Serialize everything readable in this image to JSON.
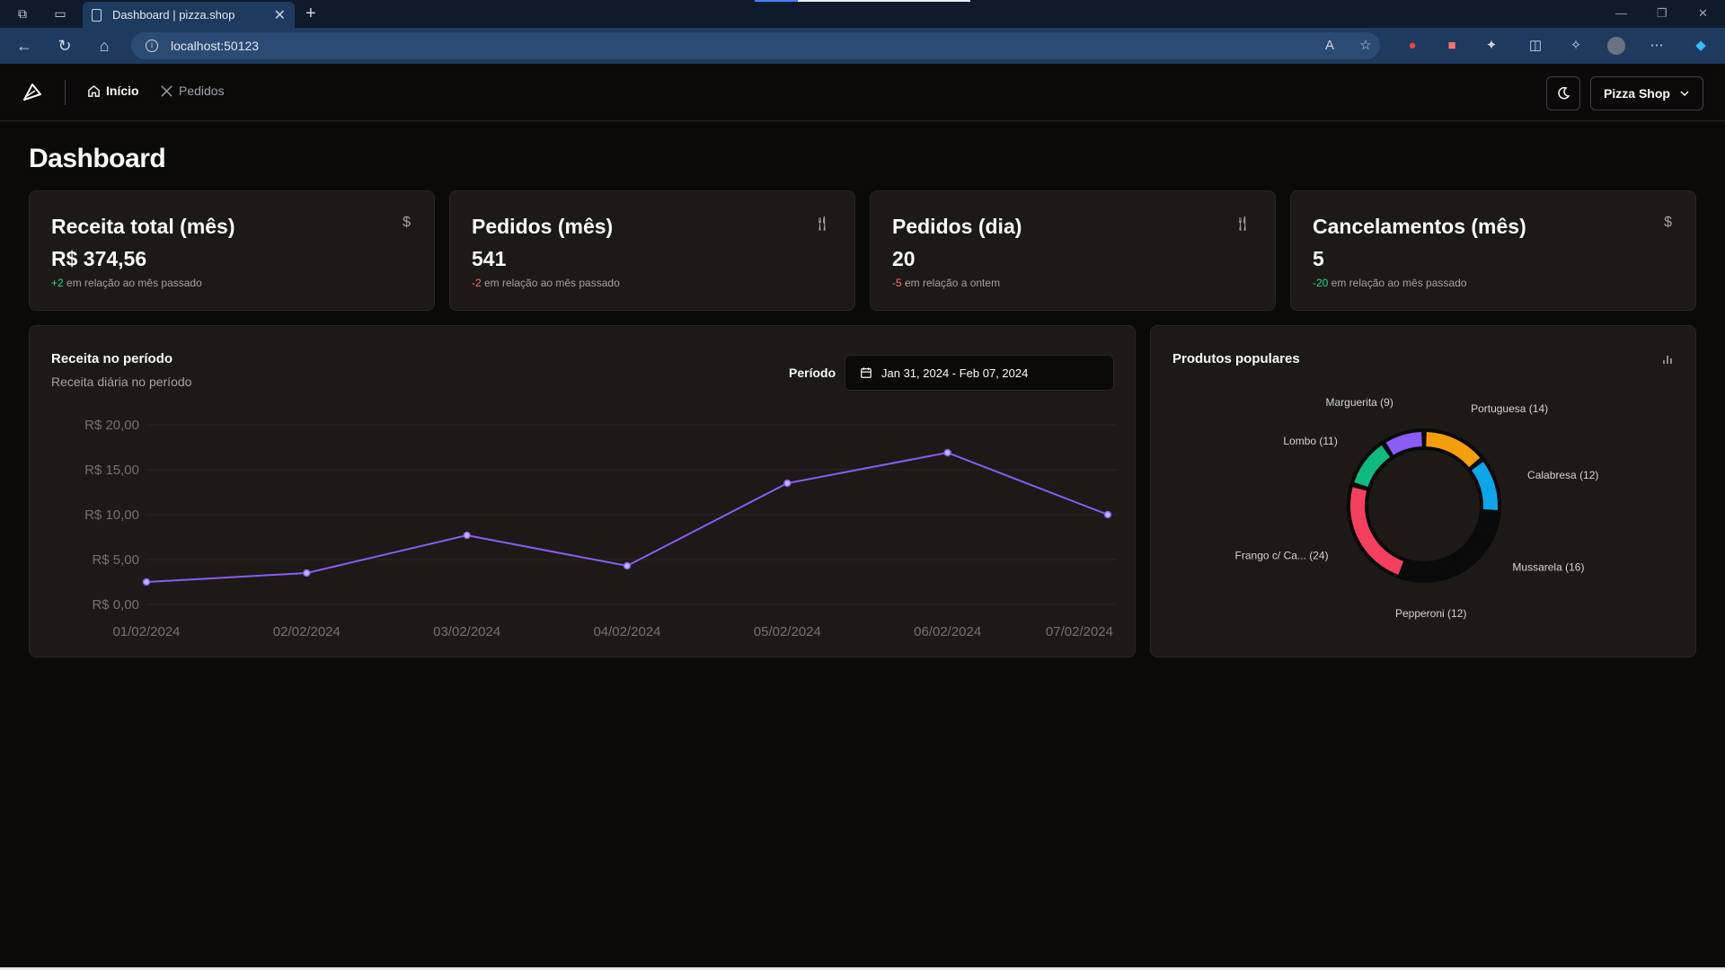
{
  "browser": {
    "tab_title": "Dashboard | pizza.shop",
    "url": "localhost:50123"
  },
  "nav": {
    "items": [
      {
        "label": "Início"
      },
      {
        "label": "Pedidos"
      }
    ],
    "shop_label": "Pizza Shop"
  },
  "page": {
    "title": "Dashboard"
  },
  "stats": [
    {
      "label": "Receita total (mês)",
      "icon": "dollar-icon",
      "value": "R$ 374,56",
      "delta": "+2",
      "delta_color": "#34d399",
      "note": " em relação ao mês passado"
    },
    {
      "label": "Pedidos (mês)",
      "icon": "utensils-icon",
      "value": "541",
      "delta": "-2",
      "delta_color": "#f87171",
      "note": " em relação ao mês passado"
    },
    {
      "label": "Pedidos (dia)",
      "icon": "utensils-icon",
      "value": "20",
      "delta": "-5",
      "delta_color": "#f87171",
      "note": " em relação a ontem"
    },
    {
      "label": "Cancelamentos (mês)",
      "icon": "dollar-icon",
      "value": "5",
      "delta": "-20",
      "delta_color": "#34d399",
      "note": " em relação ao mês passado"
    }
  ],
  "revenue": {
    "title": "Receita no período",
    "subtitle": "Receita diária no período",
    "period_label": "Período",
    "date_range": "Jan 31, 2024 - Feb 07, 2024"
  },
  "popular": {
    "title": "Produtos populares"
  },
  "chart_data": [
    {
      "type": "line",
      "title": "Receita no período",
      "x": [
        "01/02/2024",
        "02/02/2024",
        "03/02/2024",
        "04/02/2024",
        "05/02/2024",
        "06/02/2024",
        "07/02/2024"
      ],
      "series": [
        {
          "values": [
            2.5,
            3.5,
            7.7,
            4.3,
            13.5,
            16.9,
            10.0
          ]
        }
      ],
      "yticks": [
        "R$ 0,00",
        "R$ 5,00",
        "R$ 10,00",
        "R$ 15,00",
        "R$ 20,00"
      ],
      "ylim": [
        0,
        20
      ],
      "color": "#8b5cf6",
      "grid": true
    },
    {
      "type": "pie",
      "title": "Produtos populares",
      "slices": [
        {
          "label": "Portuguesa (14)",
          "value": 14,
          "color": "#f59e0b"
        },
        {
          "label": "Calabresa (12)",
          "value": 12,
          "color": "#0ea5e9"
        },
        {
          "label": "Mussarela (16)",
          "value": 16,
          "color": "#0a0a0a"
        },
        {
          "label": "Pepperoni (12)",
          "value": 12,
          "color": "#0a0a0a"
        },
        {
          "label": "Frango c/ Ca... (24)",
          "value": 24,
          "color": "#f43f5e"
        },
        {
          "label": "Lombo (11)",
          "value": 11,
          "color": "#10b981"
        },
        {
          "label": "Marguerita (9)",
          "value": 9,
          "color": "#8b5cf6"
        }
      ]
    }
  ]
}
